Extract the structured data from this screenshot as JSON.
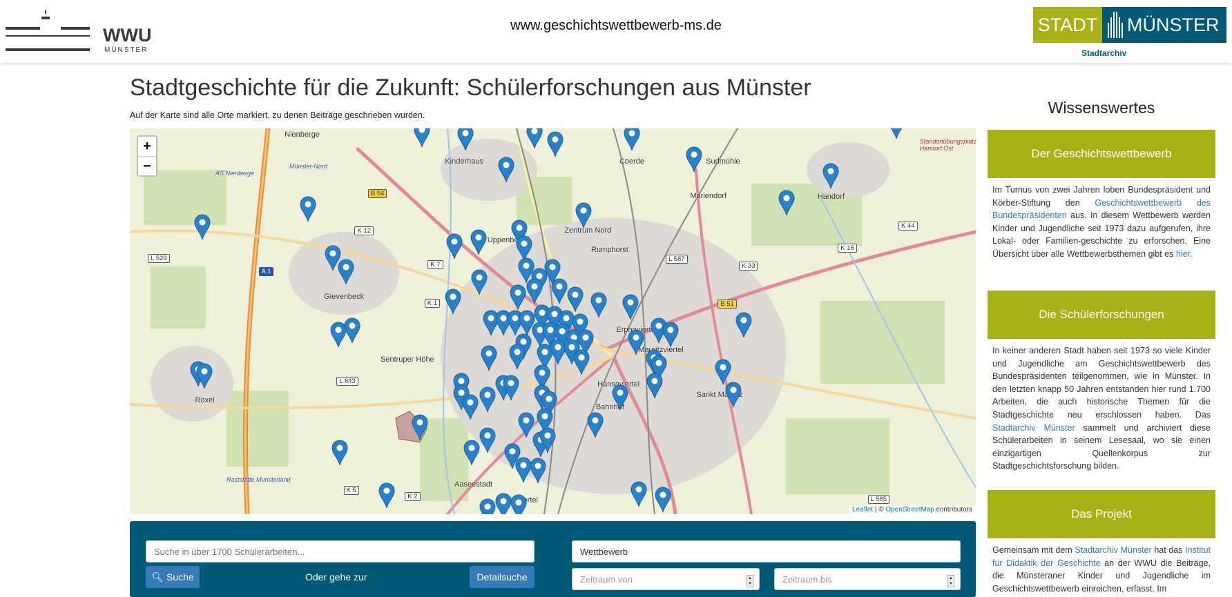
{
  "header": {
    "url": "www.geschichtswettbewerb-ms.de",
    "wwu_logo": "WWU",
    "wwu_sub": "MÜNSTER",
    "stadt_logo_left": "STADT",
    "stadt_logo_right": "MÜNSTER",
    "stadtarchiv": "Stadtarchiv"
  },
  "main": {
    "title": "Stadtgeschichte für die Zukunft: Schülerforschungen aus Münster",
    "subtitle": "Auf der Karte sind alle Orte markiert, zu denen Beiträge geschrieben wurden."
  },
  "map": {
    "zoom_in": "+",
    "zoom_out": "−",
    "attribution_leaflet": "Leaflet",
    "attribution_sep": " | © ",
    "attribution_osm": "OpenStreetMap",
    "attribution_tail": " contributors",
    "places": [
      "Nienberge",
      "Kinderhaus",
      "Coerde",
      "Sudmühle",
      "Handorf",
      "Mariendorf",
      "Gievenbeck",
      "Zentrum Nord",
      "Rumphorst",
      "Uppenberg",
      "Sentruper Höhe",
      "Roxel",
      "Aaseestadt",
      "Geistviertel",
      "Bahnhof",
      "Sankt Mauritz",
      "Mauritzviertel",
      "Hansaviertel",
      "Erphoviertel",
      "Münster-Nord",
      "AS Nienberge",
      "Raststätte Münsterland",
      "Standortübungsplatz Handorf Ost"
    ],
    "roads": [
      "B 54",
      "K 12",
      "L 529",
      "A 1",
      "K 7",
      "K 1",
      "L 587",
      "K 33",
      "K 16",
      "K 44",
      "B 51",
      "L 843",
      "K 5",
      "K 2",
      "L 585"
    ],
    "marker_icon": "map-marker-icon",
    "marker_color": "#2a81cb"
  },
  "search": {
    "placeholder": "Suche in über 1700 Schülerarbeiten...",
    "search_button": "Suche",
    "or_text": "Oder gehe zur",
    "detail_button": "Detailsuche",
    "competition_value": "Wettbewerb",
    "from_placeholder": "Zeitraum von",
    "to_placeholder": "Zeitraum bis"
  },
  "sidebar": {
    "title": "Wissenswertes",
    "sections": [
      {
        "heading": "Der Geschichtswettbewerb",
        "t1": "Im Turnus von zwei Jahren loben Bundespräsident und Körber-Stiftung den ",
        "link1": "Geschichtswettbewerb des Bundespräsidenten",
        "t2": " aus. In diesem Wettbewerb werden Kinder und Jugendliche seit 1973 dazu aufgerufen, ihre Lokal- oder Familien-geschichte zu erforschen. Eine Übersicht über alle Wettbewerbsthemen gibt es ",
        "link2": "hier.",
        "t3": ""
      },
      {
        "heading": "Die Schülerforschungen",
        "t1": "In keiner anderen Stadt haben seit 1973 so viele Kinder und Jugendliche am Geschichtswettbewerb des Bundespräsidenten teilgenommen, wie in Münster. In den letzten knapp 50 Jahren entstanden hier rund 1.700 Arbeiten, die auch historische Themen für die Stadtgeschichte neu erschlossen haben. Das ",
        "link1": "Stadtarchiv Münster",
        "t2": " sammelt und archiviert diese Schülerarbeiten in seinem Lesesaal, wo sie einen einzigartigen Quellenkorpus zur Stadtgeschichtsforschung bilden."
      },
      {
        "heading": "Das Projekt",
        "t1": "Gemeinsam mit dem ",
        "link1": "Stadtarchiv Münster",
        "t2": " hat das ",
        "link2": "Institut für Didaktik der Geschichte",
        "t3": " an der WWU die Beiträge, die Münsteraner Kinder und Jugendliche im Geschichtswettbewerb einreichen, erfasst. Im"
      }
    ]
  },
  "colors": {
    "green": "#a8b217",
    "teal": "#005a75",
    "button": "#337ab7",
    "link": "#337ab7"
  }
}
